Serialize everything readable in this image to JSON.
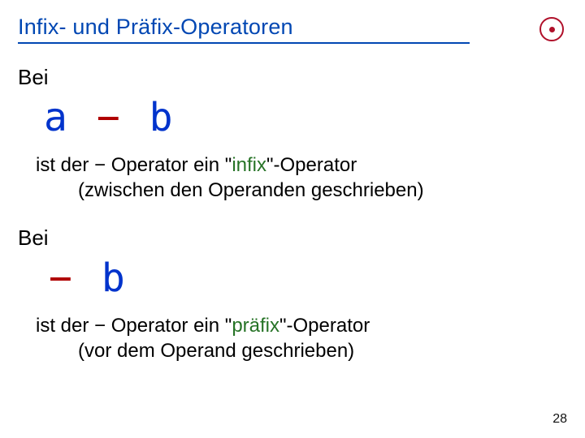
{
  "title": "Infix- und Präfix-Operatoren",
  "section1": {
    "lead": "Bei",
    "expr": {
      "a": "a",
      "op": "−",
      "b": "b"
    },
    "desc_pre": "ist der − Operator ein \"",
    "keyword": "infix",
    "desc_post": "\"-Operator",
    "desc_sub": "(zwischen den Operanden geschrieben)"
  },
  "section2": {
    "lead": "Bei",
    "expr": {
      "op": "−",
      "b": "b"
    },
    "desc_pre": "ist der − Operator ein \"",
    "keyword": "präfix",
    "desc_post": "\"-Operator",
    "desc_sub": "(vor dem Operand geschrieben)"
  },
  "page_number": "28"
}
